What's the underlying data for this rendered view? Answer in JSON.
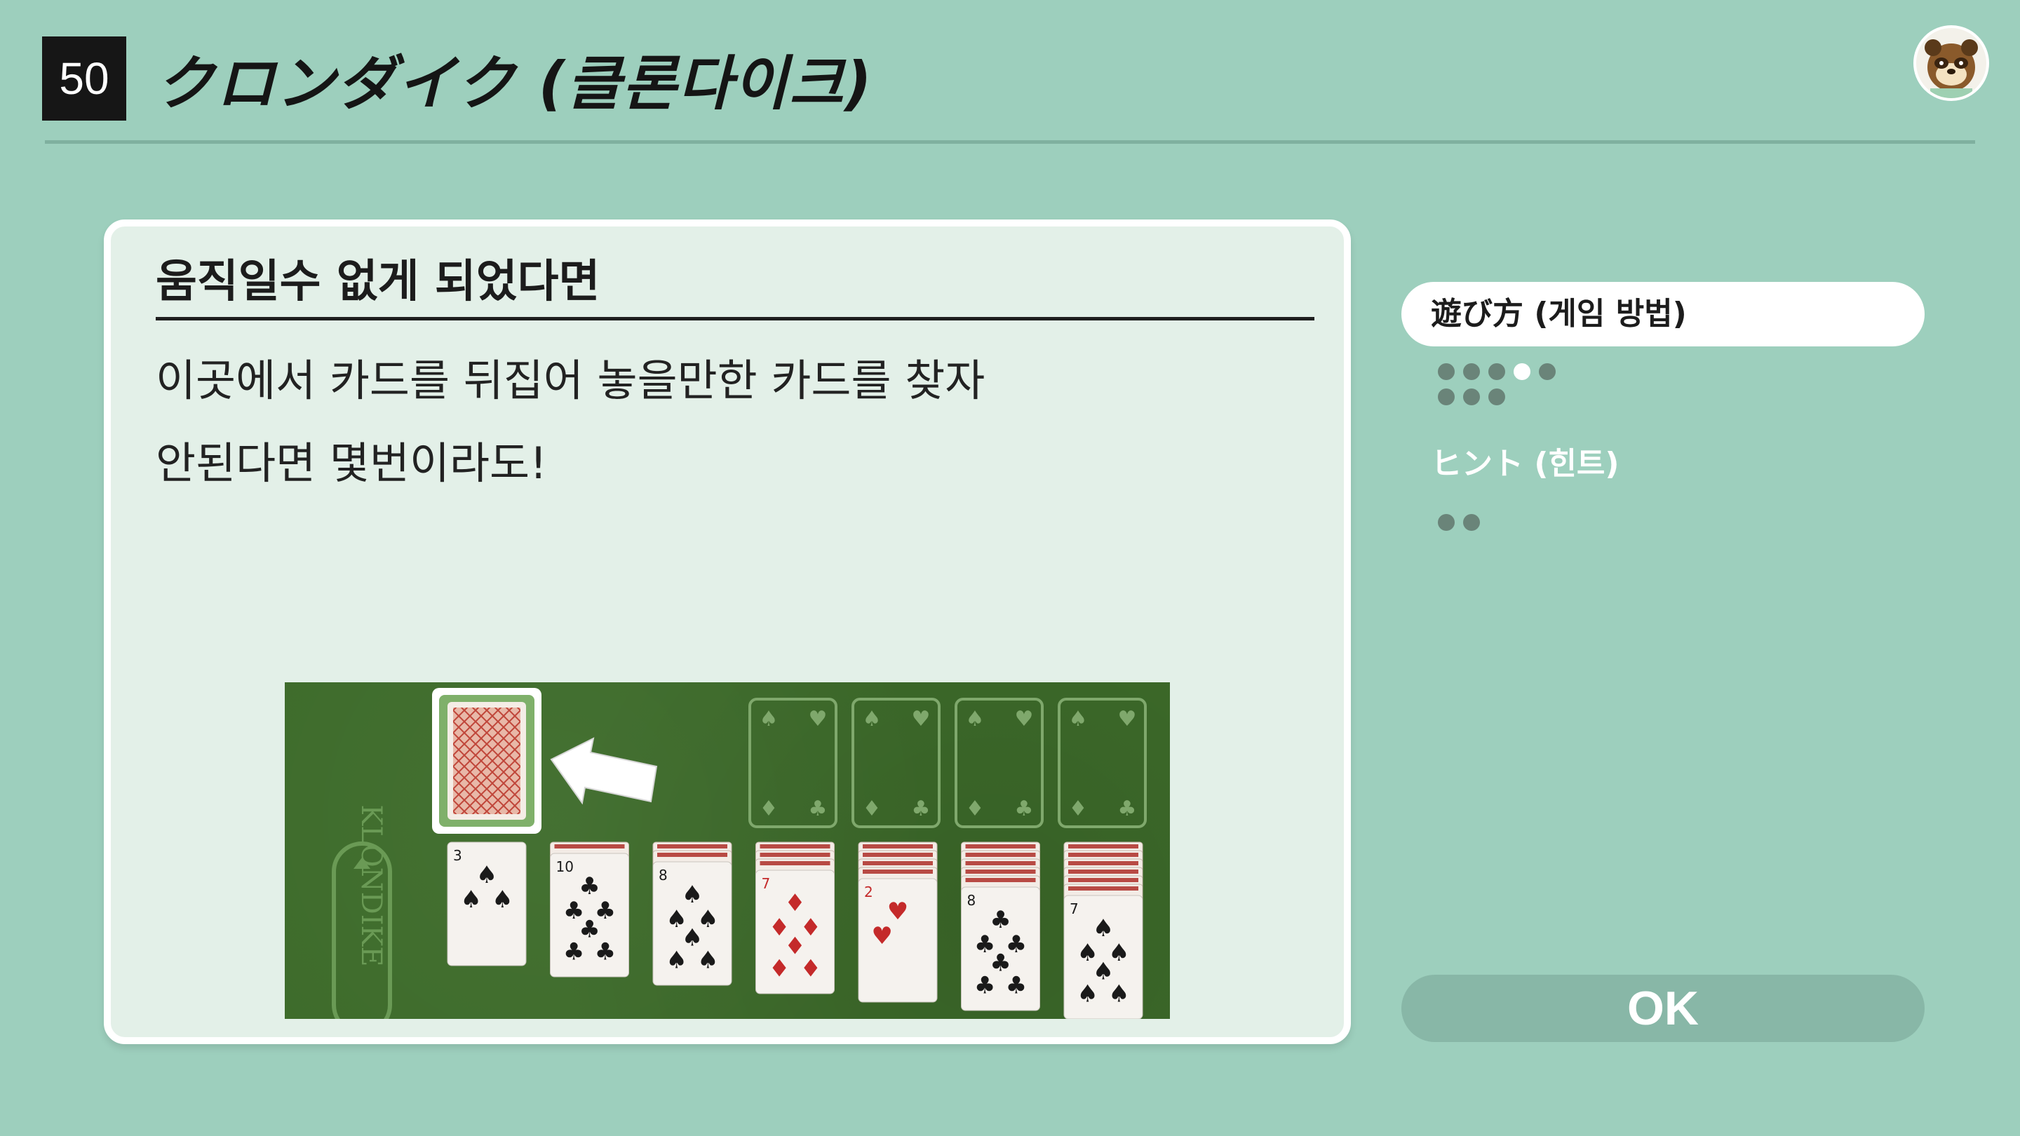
{
  "header": {
    "number": "50",
    "title": "クロンダイク (클론다이크)"
  },
  "panel": {
    "heading": "움직일수 없게 되었다면",
    "line1": "이곳에서 카드를 뒤집어 놓을만한 카드를 찾자",
    "line2": "안된다면 몇번이라도!"
  },
  "side": {
    "tabs": [
      {
        "label": "遊び方 (게임 방법)",
        "pages": 8,
        "current": 4
      },
      {
        "label": "ヒント (힌트)",
        "pages": 2
      }
    ],
    "ok_label": "OK"
  },
  "game_screenshot": {
    "deck_text": "KLONDIKE",
    "foundation_suit": "spade",
    "tableau_ranks": [
      "3",
      "10",
      "8",
      "7",
      "2",
      "8",
      "7"
    ],
    "tableau_suits": [
      "spade",
      "club",
      "spade",
      "diamond",
      "heart",
      "club",
      "spade"
    ]
  },
  "colors": {
    "background": "#9dcfbd",
    "panel": "#e3f0e8",
    "felt": "#3d6b2a",
    "ok_button": "#88b7a7"
  }
}
